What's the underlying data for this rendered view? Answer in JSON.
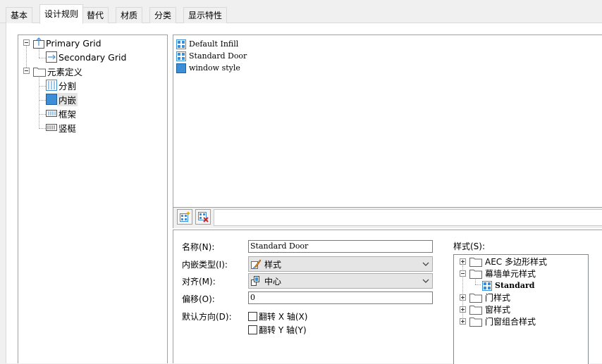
{
  "tabs": [
    "基本",
    "设计规则",
    "替代",
    "材质",
    "分类",
    "显示特性"
  ],
  "active_tab": "设计规则",
  "tree": {
    "items": [
      {
        "label": "Primary Grid",
        "icon": "primary-grid-icon"
      },
      {
        "label": "Secondary Grid",
        "icon": "secondary-grid-icon"
      },
      {
        "label": "元素定义",
        "icon": "folder-icon"
      },
      {
        "label": "分割",
        "icon": "division-icon"
      },
      {
        "label": "内嵌",
        "icon": "infill-icon"
      },
      {
        "label": "框架",
        "icon": "frame-icon"
      },
      {
        "label": "竖梃",
        "icon": "mullion-icon"
      }
    ],
    "selected": "内嵌"
  },
  "infill_list": {
    "items": [
      "Default Infill",
      "Standard Door",
      "window style"
    ]
  },
  "toolbar": {
    "new_icon": "new-infill-icon",
    "delete_icon": "delete-infill-icon"
  },
  "props": {
    "name_label": "名称(N):",
    "name_value": "Standard Door",
    "infill_type_label": "内嵌类型(I):",
    "infill_type_value": "样式",
    "align_label": "对齐(M):",
    "align_value": "中心",
    "offset_label": "偏移(O):",
    "offset_value": "0",
    "orientation_label": "默认方向(D):",
    "flip_x_label": "翻转 X 轴(X)",
    "flip_y_label": "翻转 Y 轴(Y)"
  },
  "styles": {
    "label": "样式(S):",
    "items": [
      {
        "label": "AEC 多边形样式",
        "expander": "plus"
      },
      {
        "label": "幕墙单元样式",
        "expander": "minus"
      },
      {
        "label": "Standard",
        "expander": "none"
      },
      {
        "label": "门样式",
        "expander": "plus"
      },
      {
        "label": "窗样式",
        "expander": "plus"
      },
      {
        "label": "门窗组合样式",
        "expander": "plus"
      }
    ]
  },
  "colors": {
    "selection_blue": "#3c8fd6",
    "tab_border": "#d9d9d9",
    "pane_border": "#a0a0a0"
  }
}
